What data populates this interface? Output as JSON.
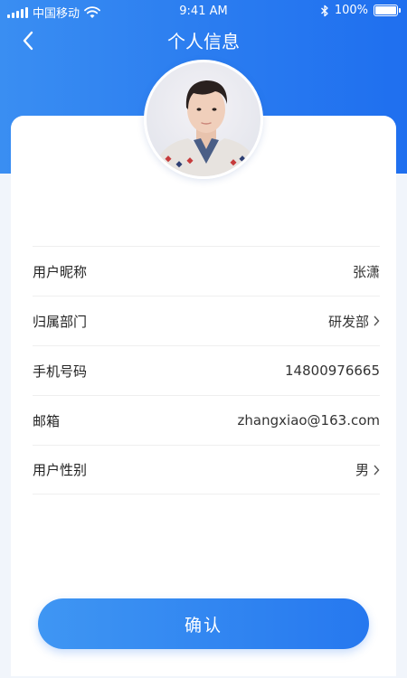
{
  "status_bar": {
    "carrier": "中国移动",
    "time": "9:41 AM",
    "battery_text": "100%",
    "battery_level": 1.0
  },
  "nav": {
    "title": "个人信息",
    "back_icon": "chevron-left-icon"
  },
  "profile": {
    "avatar_icon": "user-avatar-photo",
    "fields": [
      {
        "label": "用户昵称",
        "value": "张潇",
        "has_arrow": false
      },
      {
        "label": "归属部门",
        "value": "研发部",
        "has_arrow": true
      },
      {
        "label": "手机号码",
        "value": "14800976665",
        "has_arrow": false
      },
      {
        "label": "邮箱",
        "value": "zhangxiao@163.com",
        "has_arrow": false
      },
      {
        "label": "用户性别",
        "value": "男",
        "has_arrow": true
      }
    ]
  },
  "confirm_label": "确认",
  "colors": {
    "primary": "#2b7df0",
    "page_bg": "#f1f5fb",
    "card_bg": "#ffffff"
  }
}
